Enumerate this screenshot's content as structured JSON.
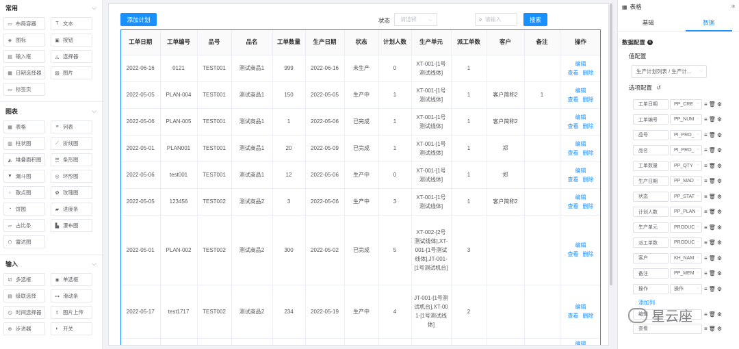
{
  "palette": {
    "groups": [
      {
        "title": "常用",
        "items": [
          {
            "label": "布局容器",
            "icon": "layout-icon",
            "glyph": "▭"
          },
          {
            "label": "文本",
            "icon": "text-icon",
            "glyph": "T"
          },
          {
            "label": "图标",
            "icon": "icon-icon",
            "glyph": "◈"
          },
          {
            "label": "按钮",
            "icon": "button-icon",
            "glyph": "▣"
          },
          {
            "label": "输入框",
            "icon": "input-icon",
            "glyph": "▤"
          },
          {
            "label": "选择器",
            "icon": "select-icon",
            "glyph": "◬"
          },
          {
            "label": "日期选择器",
            "icon": "date-picker-icon",
            "glyph": "▦"
          },
          {
            "label": "图片",
            "icon": "image-icon",
            "glyph": "▨"
          },
          {
            "label": "标签页",
            "icon": "tabs-icon",
            "glyph": "▭"
          }
        ]
      },
      {
        "title": "图表",
        "items": [
          {
            "label": "表格",
            "icon": "table-icon",
            "glyph": "▦"
          },
          {
            "label": "列表",
            "icon": "list-icon",
            "glyph": "≡"
          },
          {
            "label": "柱状图",
            "icon": "bar-chart-icon",
            "glyph": "▥"
          },
          {
            "label": "折线图",
            "icon": "line-chart-icon",
            "glyph": "⟋"
          },
          {
            "label": "堆叠面积图",
            "icon": "stacked-area-icon",
            "glyph": "◭"
          },
          {
            "label": "条形图",
            "icon": "hbar-chart-icon",
            "glyph": "☰"
          },
          {
            "label": "漏斗图",
            "icon": "funnel-icon",
            "glyph": "▼"
          },
          {
            "label": "环形图",
            "icon": "ring-chart-icon",
            "glyph": "◎"
          },
          {
            "label": "散点图",
            "icon": "scatter-icon",
            "glyph": "⁘"
          },
          {
            "label": "玫瑰图",
            "icon": "rose-chart-icon",
            "glyph": "✿"
          },
          {
            "label": "饼图",
            "icon": "pie-chart-icon",
            "glyph": "◔"
          },
          {
            "label": "进度条",
            "icon": "progress-icon",
            "glyph": "▰"
          },
          {
            "label": "占比条",
            "icon": "ratio-bar-icon",
            "glyph": "▱"
          },
          {
            "label": "瀑布图",
            "icon": "waterfall-icon",
            "glyph": "▙"
          },
          {
            "label": "雷达图",
            "icon": "radar-icon",
            "glyph": "⬡"
          }
        ]
      },
      {
        "title": "输入",
        "items": [
          {
            "label": "多选框",
            "icon": "checkbox-icon",
            "glyph": "☑"
          },
          {
            "label": "单选框",
            "icon": "radio-icon",
            "glyph": "◉"
          },
          {
            "label": "级联选择",
            "icon": "cascader-icon",
            "glyph": "▤"
          },
          {
            "label": "滑动条",
            "icon": "slider-icon",
            "glyph": "⊶"
          },
          {
            "label": "时间选择器",
            "icon": "time-picker-icon",
            "glyph": "◷"
          },
          {
            "label": "图片上传",
            "icon": "upload-icon",
            "glyph": "⇧"
          },
          {
            "label": "步进器",
            "icon": "stepper-icon",
            "glyph": "⊕"
          },
          {
            "label": "开关",
            "icon": "switch-icon",
            "glyph": "◐"
          }
        ]
      }
    ]
  },
  "toolbar": {
    "add_label": "添加计划",
    "status_label": "状态",
    "status_placeholder": "请选择",
    "search_placeholder": "请输入",
    "search_label": "搜索"
  },
  "table": {
    "columns": [
      "工单日期",
      "工单编号",
      "品号",
      "品名",
      "工单数量",
      "生产日期",
      "状态",
      "计划人数",
      "生产单元",
      "派工单数",
      "客户",
      "备注",
      "操作"
    ],
    "op_edit": "编辑",
    "op_view": "查看",
    "op_delete": "删除",
    "rows": [
      [
        "2022-06-16",
        "0121",
        "TEST001",
        "测试商品1",
        "999",
        "2022-06-16",
        "未生产",
        "0",
        "XT-001-[1号测试线体]",
        "1",
        "",
        ""
      ],
      [
        "2022-05-05",
        "PLAN-004",
        "TEST001",
        "测试商品1",
        "150",
        "2022-05-05",
        "生产中",
        "1",
        "XT-001-[1号测试线体]",
        "1",
        "客户简称2",
        "1"
      ],
      [
        "2022-05-06",
        "PLAN-005",
        "TEST001",
        "测试商品1",
        "1",
        "2022-05-06",
        "已完成",
        "1",
        "XT-001-[1号测试线体]",
        "1",
        "客户简称2",
        ""
      ],
      [
        "2022-05-01",
        "PLAN001",
        "TEST001",
        "测试商品1",
        "20",
        "2022-05-09",
        "已完成",
        "1",
        "XT-001-[1号测试线体]",
        "1",
        "郑",
        ""
      ],
      [
        "2022-05-06",
        "test001",
        "TEST001",
        "测试商品1",
        "12",
        "2022-05-06",
        "生产中",
        "0",
        "XT-001-[1号测试线体]",
        "1",
        "郑",
        ""
      ],
      [
        "2022-05-05",
        "123456",
        "TEST002",
        "测试商品2",
        "3",
        "2022-05-06",
        "生产中",
        "3",
        "XT-001-[1号测试线体]",
        "1",
        "客户简称2",
        ""
      ],
      [
        "2022-05-01",
        "PLAN-002",
        "TEST002",
        "测试商品2",
        "300",
        "2022-05-02",
        "已完成",
        "5",
        "XT-002-[2号测试线体],XT-001-[1号测试线体],JT-001-[1号测试机台]",
        "3",
        "",
        ""
      ],
      [
        "2022-05-17",
        "test1717",
        "TEST002",
        "测试商品2",
        "234",
        "2022-05-19",
        "生产中",
        "4",
        "JT-001-[1号测试机台],XT-001-[1号测试线体]",
        "2",
        "",
        ""
      ],
      [
        "",
        "",
        "",
        "",
        "",
        "",
        "",
        "",
        "JT-001-[1号",
        "",
        "",
        ""
      ]
    ]
  },
  "right_panel": {
    "header": "表格",
    "tabs": [
      "基础",
      "数据"
    ],
    "section": "数据配置",
    "value_config": "值配置",
    "value_path": "生产计划列表 / 生产计...",
    "option_config": "选项配置",
    "options": [
      {
        "label": "工单日期",
        "field": "PP_CRE"
      },
      {
        "label": "工单编号",
        "field": "PP_NUM"
      },
      {
        "label": "品号",
        "field": "PI_PRO_"
      },
      {
        "label": "品名",
        "field": "PI_PRO_"
      },
      {
        "label": "工单数量",
        "field": "PP_QTY"
      },
      {
        "label": "生产日期",
        "field": "PP_MAD"
      },
      {
        "label": "状态",
        "field": "PP_STAT"
      },
      {
        "label": "计划人数",
        "field": "PP_PLAN"
      },
      {
        "label": "生产单元",
        "field": "PRODUC"
      },
      {
        "label": "派工单数",
        "field": "PRODUC"
      },
      {
        "label": "客户",
        "field": "KH_NAM"
      },
      {
        "label": "备注",
        "field": "PP_MEM"
      },
      {
        "label": "操作",
        "field": "操作"
      }
    ],
    "add_column": "添加列",
    "extra": [
      "编辑",
      "查看"
    ]
  },
  "watermark": "星云座"
}
